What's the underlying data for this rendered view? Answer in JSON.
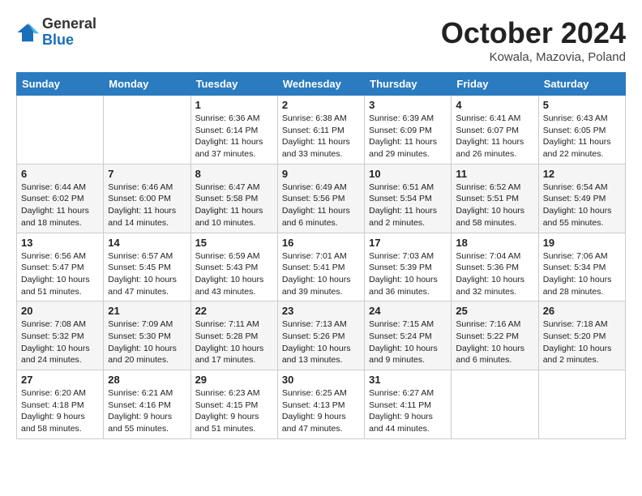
{
  "logo": {
    "general": "General",
    "blue": "Blue"
  },
  "title": {
    "month": "October 2024",
    "location": "Kowala, Mazovia, Poland"
  },
  "headers": [
    "Sunday",
    "Monday",
    "Tuesday",
    "Wednesday",
    "Thursday",
    "Friday",
    "Saturday"
  ],
  "weeks": [
    [
      {
        "num": "",
        "sunrise": "",
        "sunset": "",
        "daylight": ""
      },
      {
        "num": "",
        "sunrise": "",
        "sunset": "",
        "daylight": ""
      },
      {
        "num": "1",
        "sunrise": "Sunrise: 6:36 AM",
        "sunset": "Sunset: 6:14 PM",
        "daylight": "Daylight: 11 hours and 37 minutes."
      },
      {
        "num": "2",
        "sunrise": "Sunrise: 6:38 AM",
        "sunset": "Sunset: 6:11 PM",
        "daylight": "Daylight: 11 hours and 33 minutes."
      },
      {
        "num": "3",
        "sunrise": "Sunrise: 6:39 AM",
        "sunset": "Sunset: 6:09 PM",
        "daylight": "Daylight: 11 hours and 29 minutes."
      },
      {
        "num": "4",
        "sunrise": "Sunrise: 6:41 AM",
        "sunset": "Sunset: 6:07 PM",
        "daylight": "Daylight: 11 hours and 26 minutes."
      },
      {
        "num": "5",
        "sunrise": "Sunrise: 6:43 AM",
        "sunset": "Sunset: 6:05 PM",
        "daylight": "Daylight: 11 hours and 22 minutes."
      }
    ],
    [
      {
        "num": "6",
        "sunrise": "Sunrise: 6:44 AM",
        "sunset": "Sunset: 6:02 PM",
        "daylight": "Daylight: 11 hours and 18 minutes."
      },
      {
        "num": "7",
        "sunrise": "Sunrise: 6:46 AM",
        "sunset": "Sunset: 6:00 PM",
        "daylight": "Daylight: 11 hours and 14 minutes."
      },
      {
        "num": "8",
        "sunrise": "Sunrise: 6:47 AM",
        "sunset": "Sunset: 5:58 PM",
        "daylight": "Daylight: 11 hours and 10 minutes."
      },
      {
        "num": "9",
        "sunrise": "Sunrise: 6:49 AM",
        "sunset": "Sunset: 5:56 PM",
        "daylight": "Daylight: 11 hours and 6 minutes."
      },
      {
        "num": "10",
        "sunrise": "Sunrise: 6:51 AM",
        "sunset": "Sunset: 5:54 PM",
        "daylight": "Daylight: 11 hours and 2 minutes."
      },
      {
        "num": "11",
        "sunrise": "Sunrise: 6:52 AM",
        "sunset": "Sunset: 5:51 PM",
        "daylight": "Daylight: 10 hours and 58 minutes."
      },
      {
        "num": "12",
        "sunrise": "Sunrise: 6:54 AM",
        "sunset": "Sunset: 5:49 PM",
        "daylight": "Daylight: 10 hours and 55 minutes."
      }
    ],
    [
      {
        "num": "13",
        "sunrise": "Sunrise: 6:56 AM",
        "sunset": "Sunset: 5:47 PM",
        "daylight": "Daylight: 10 hours and 51 minutes."
      },
      {
        "num": "14",
        "sunrise": "Sunrise: 6:57 AM",
        "sunset": "Sunset: 5:45 PM",
        "daylight": "Daylight: 10 hours and 47 minutes."
      },
      {
        "num": "15",
        "sunrise": "Sunrise: 6:59 AM",
        "sunset": "Sunset: 5:43 PM",
        "daylight": "Daylight: 10 hours and 43 minutes."
      },
      {
        "num": "16",
        "sunrise": "Sunrise: 7:01 AM",
        "sunset": "Sunset: 5:41 PM",
        "daylight": "Daylight: 10 hours and 39 minutes."
      },
      {
        "num": "17",
        "sunrise": "Sunrise: 7:03 AM",
        "sunset": "Sunset: 5:39 PM",
        "daylight": "Daylight: 10 hours and 36 minutes."
      },
      {
        "num": "18",
        "sunrise": "Sunrise: 7:04 AM",
        "sunset": "Sunset: 5:36 PM",
        "daylight": "Daylight: 10 hours and 32 minutes."
      },
      {
        "num": "19",
        "sunrise": "Sunrise: 7:06 AM",
        "sunset": "Sunset: 5:34 PM",
        "daylight": "Daylight: 10 hours and 28 minutes."
      }
    ],
    [
      {
        "num": "20",
        "sunrise": "Sunrise: 7:08 AM",
        "sunset": "Sunset: 5:32 PM",
        "daylight": "Daylight: 10 hours and 24 minutes."
      },
      {
        "num": "21",
        "sunrise": "Sunrise: 7:09 AM",
        "sunset": "Sunset: 5:30 PM",
        "daylight": "Daylight: 10 hours and 20 minutes."
      },
      {
        "num": "22",
        "sunrise": "Sunrise: 7:11 AM",
        "sunset": "Sunset: 5:28 PM",
        "daylight": "Daylight: 10 hours and 17 minutes."
      },
      {
        "num": "23",
        "sunrise": "Sunrise: 7:13 AM",
        "sunset": "Sunset: 5:26 PM",
        "daylight": "Daylight: 10 hours and 13 minutes."
      },
      {
        "num": "24",
        "sunrise": "Sunrise: 7:15 AM",
        "sunset": "Sunset: 5:24 PM",
        "daylight": "Daylight: 10 hours and 9 minutes."
      },
      {
        "num": "25",
        "sunrise": "Sunrise: 7:16 AM",
        "sunset": "Sunset: 5:22 PM",
        "daylight": "Daylight: 10 hours and 6 minutes."
      },
      {
        "num": "26",
        "sunrise": "Sunrise: 7:18 AM",
        "sunset": "Sunset: 5:20 PM",
        "daylight": "Daylight: 10 hours and 2 minutes."
      }
    ],
    [
      {
        "num": "27",
        "sunrise": "Sunrise: 6:20 AM",
        "sunset": "Sunset: 4:18 PM",
        "daylight": "Daylight: 9 hours and 58 minutes."
      },
      {
        "num": "28",
        "sunrise": "Sunrise: 6:21 AM",
        "sunset": "Sunset: 4:16 PM",
        "daylight": "Daylight: 9 hours and 55 minutes."
      },
      {
        "num": "29",
        "sunrise": "Sunrise: 6:23 AM",
        "sunset": "Sunset: 4:15 PM",
        "daylight": "Daylight: 9 hours and 51 minutes."
      },
      {
        "num": "30",
        "sunrise": "Sunrise: 6:25 AM",
        "sunset": "Sunset: 4:13 PM",
        "daylight": "Daylight: 9 hours and 47 minutes."
      },
      {
        "num": "31",
        "sunrise": "Sunrise: 6:27 AM",
        "sunset": "Sunset: 4:11 PM",
        "daylight": "Daylight: 9 hours and 44 minutes."
      },
      {
        "num": "",
        "sunrise": "",
        "sunset": "",
        "daylight": ""
      },
      {
        "num": "",
        "sunrise": "",
        "sunset": "",
        "daylight": ""
      }
    ]
  ]
}
